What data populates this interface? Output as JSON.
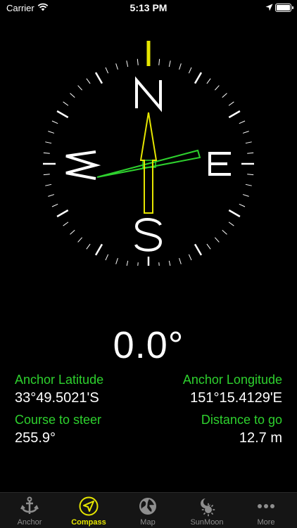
{
  "status_bar": {
    "carrier": "Carrier",
    "time": "5:13 PM"
  },
  "compass": {
    "north": "N",
    "south": "S",
    "east": "E",
    "west": "W",
    "heading_deg": 0.0,
    "course_deg": 255.9,
    "accent_yellow": "#e6e600",
    "accent_green": "#2ed12e"
  },
  "heading": "0.0°",
  "info": {
    "anchor_latitude_label": "Anchor Latitude",
    "anchor_latitude_value": "33°49.5021'S",
    "anchor_longitude_label": "Anchor Longitude",
    "anchor_longitude_value": "151°15.4129'E",
    "course_label": "Course to steer",
    "course_value": "255.9°",
    "distance_label": "Distance to go",
    "distance_value": "12.7 m"
  },
  "tabs": [
    {
      "label": "Anchor",
      "icon": "anchor-icon",
      "active": false
    },
    {
      "label": "Compass",
      "icon": "compass-navigation-icon",
      "active": true
    },
    {
      "label": "Map",
      "icon": "globe-icon",
      "active": false
    },
    {
      "label": "SunMoon",
      "icon": "sun-moon-icon",
      "active": false
    },
    {
      "label": "More",
      "icon": "more-dots-icon",
      "active": false
    }
  ]
}
